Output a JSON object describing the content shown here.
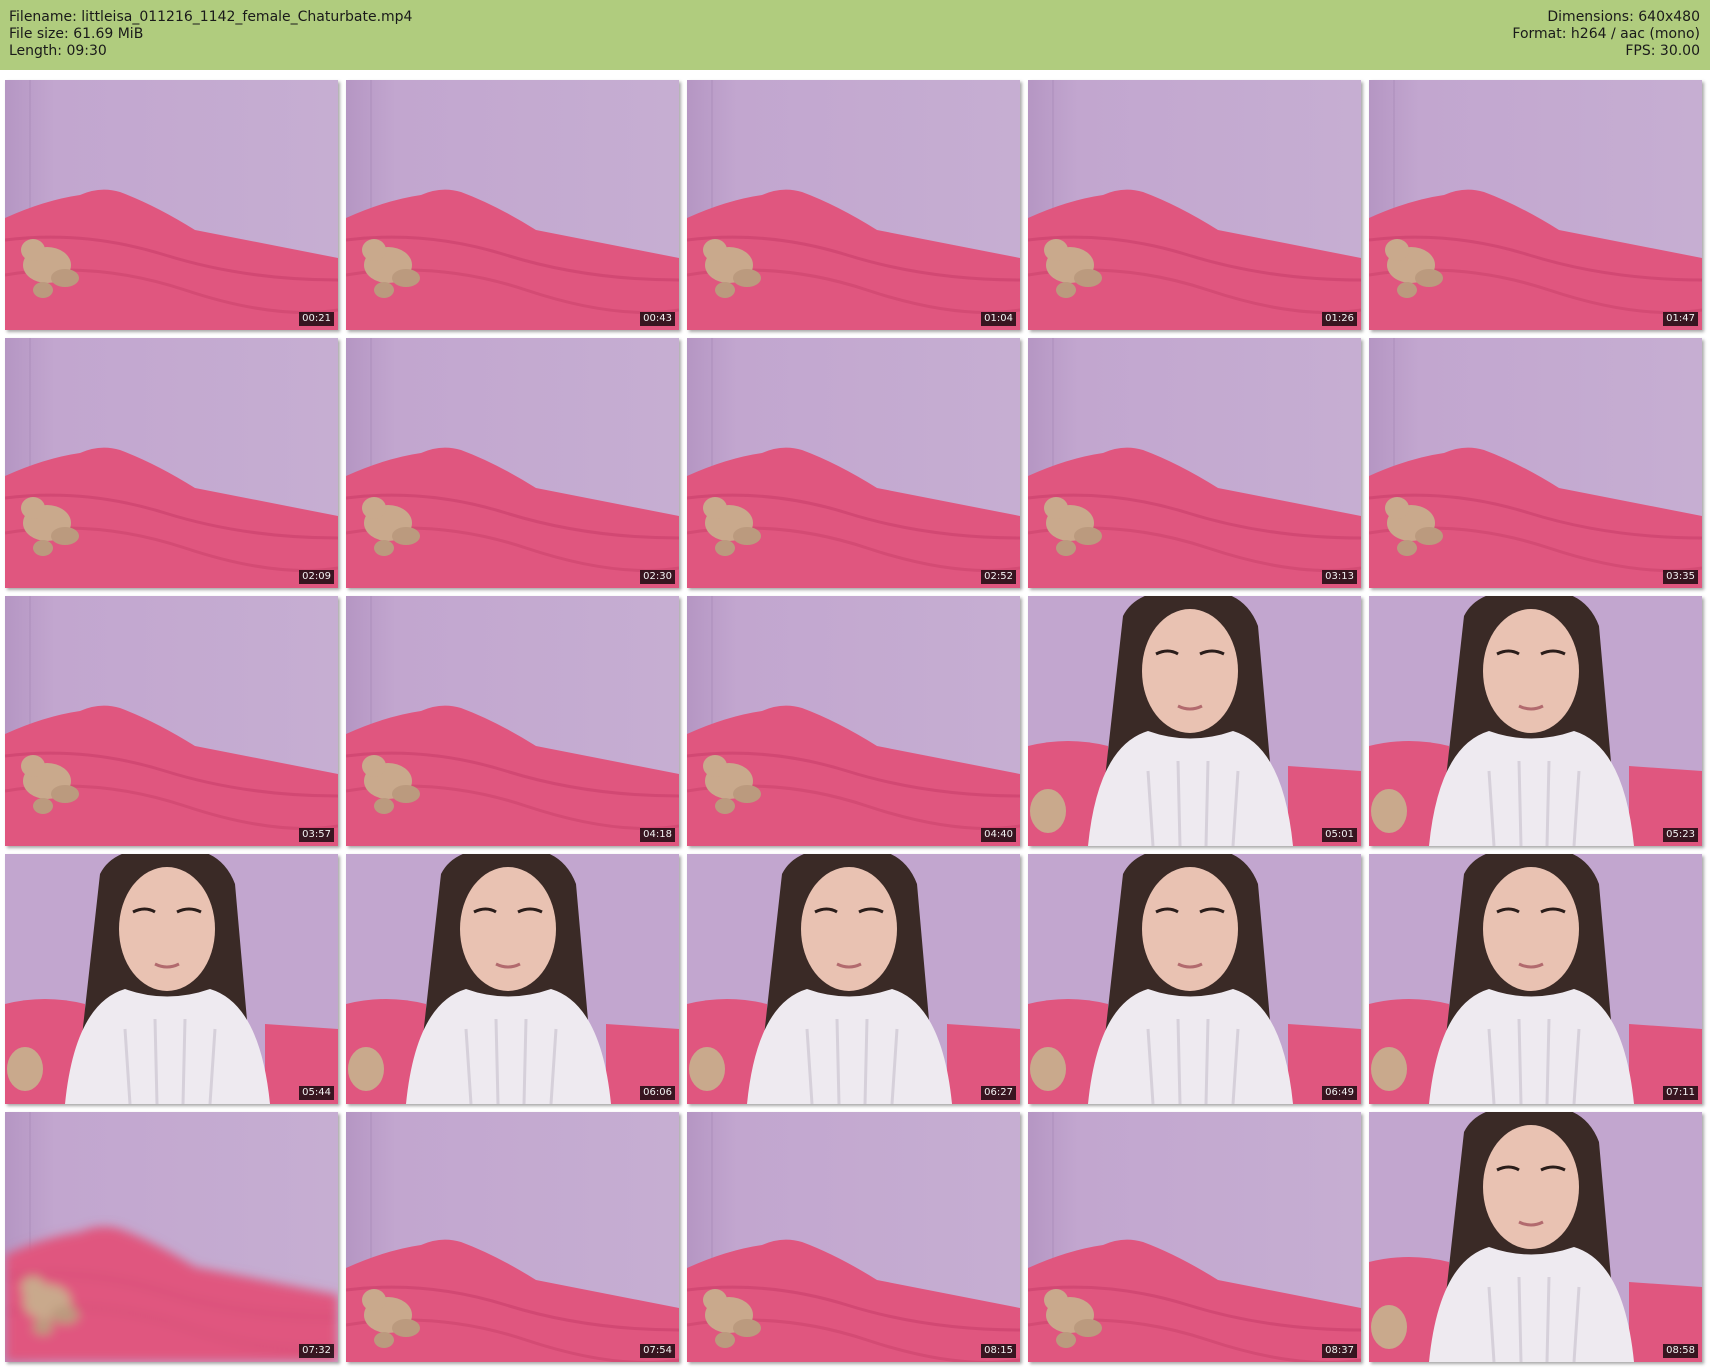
{
  "header": {
    "filename_line": "Filename: littleisa_011216_1142_female_Chaturbate.mp4",
    "filesize_line": "File size: 61.69 MiB",
    "length_line": "Length: 09:30",
    "dimensions_line": "Dimensions: 640x480",
    "format_line": "Format: h264 / aac (mono)",
    "fps_line": "FPS: 30.00"
  },
  "colors": {
    "header_bg": "#b0cc7e",
    "wall": "#c2a6cf",
    "bed": "#e0567f",
    "sweater": "#eeeaf0",
    "hair": "#3a2a26",
    "skin": "#e9c2b2",
    "teddy": "#c9a98c"
  },
  "thumbnails": [
    {
      "time": "00:21",
      "scene": "bed"
    },
    {
      "time": "00:43",
      "scene": "bed"
    },
    {
      "time": "01:04",
      "scene": "bed"
    },
    {
      "time": "01:26",
      "scene": "bed"
    },
    {
      "time": "01:47",
      "scene": "bed"
    },
    {
      "time": "02:09",
      "scene": "bed"
    },
    {
      "time": "02:30",
      "scene": "bed"
    },
    {
      "time": "02:52",
      "scene": "bed"
    },
    {
      "time": "03:13",
      "scene": "bed"
    },
    {
      "time": "03:35",
      "scene": "bed"
    },
    {
      "time": "03:57",
      "scene": "bed"
    },
    {
      "time": "04:18",
      "scene": "bed"
    },
    {
      "time": "04:40",
      "scene": "bed"
    },
    {
      "time": "05:01",
      "scene": "person"
    },
    {
      "time": "05:23",
      "scene": "person"
    },
    {
      "time": "05:44",
      "scene": "person"
    },
    {
      "time": "06:06",
      "scene": "person"
    },
    {
      "time": "06:27",
      "scene": "person"
    },
    {
      "time": "06:49",
      "scene": "person"
    },
    {
      "time": "07:11",
      "scene": "person"
    },
    {
      "time": "07:32",
      "scene": "bed-blur"
    },
    {
      "time": "07:54",
      "scene": "bed-low"
    },
    {
      "time": "08:15",
      "scene": "bed-low"
    },
    {
      "time": "08:37",
      "scene": "bed-low"
    },
    {
      "time": "08:58",
      "scene": "person"
    }
  ]
}
